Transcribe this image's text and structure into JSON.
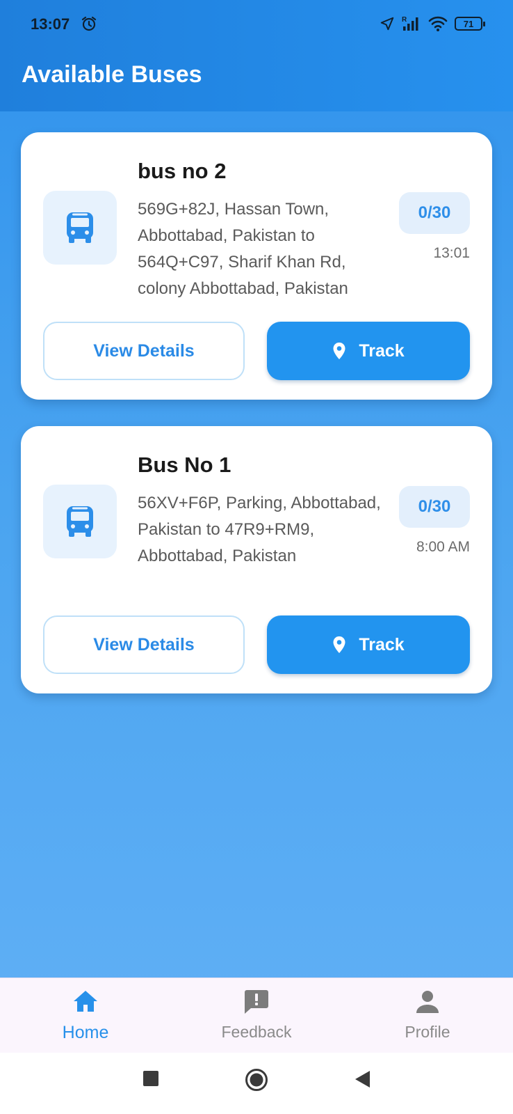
{
  "status_bar": {
    "time": "13:07",
    "battery": "71"
  },
  "app_bar": {
    "title": "Available Buses"
  },
  "buses": [
    {
      "name": "bus no 2",
      "route": "569G+82J, Hassan Town, Abbottabad, Pakistan to 564Q+C97, Sharif Khan Rd, colony Abbottabad, Pakistan",
      "seats": "0/30",
      "time": "13:01",
      "details_label": "View Details",
      "track_label": "Track"
    },
    {
      "name": "Bus No 1",
      "route": "56XV+F6P, Parking, Abbottabad, Pakistan to 47R9+RM9, Abbottabad, Pakistan",
      "seats": "0/30",
      "time": "8:00 AM",
      "details_label": "View Details",
      "track_label": "Track"
    }
  ],
  "bottom_nav": {
    "items": [
      {
        "label": "Home",
        "icon": "home-icon",
        "active": true
      },
      {
        "label": "Feedback",
        "icon": "feedback-icon",
        "active": false
      },
      {
        "label": "Profile",
        "icon": "person-icon",
        "active": false
      }
    ]
  },
  "colors": {
    "accent": "#2294ef",
    "header": "#1f7fdc",
    "badge_bg": "#e3effc",
    "nav_bg": "#fbf5fd"
  }
}
